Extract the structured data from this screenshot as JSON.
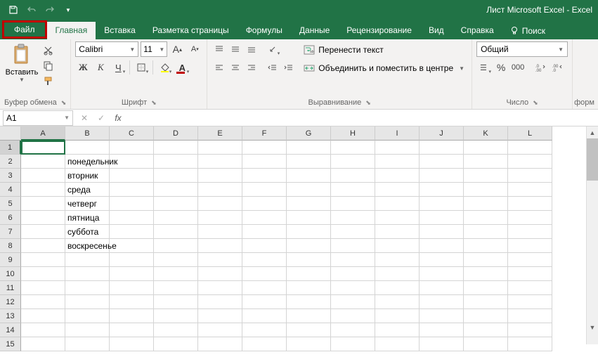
{
  "titlebar": {
    "title": "Лист Microsoft Excel  -  Excel"
  },
  "tabs": {
    "file": "Файл",
    "items": [
      "Главная",
      "Вставка",
      "Разметка страницы",
      "Формулы",
      "Данные",
      "Рецензирование",
      "Вид",
      "Справка"
    ],
    "search": "Поиск",
    "active_index": 0
  },
  "ribbon": {
    "clipboard": {
      "paste": "Вставить",
      "group": "Буфер обмена"
    },
    "font": {
      "name": "Calibri",
      "size": "11",
      "group": "Шрифт",
      "bold": "Ж",
      "italic": "К",
      "underline": "Ч",
      "increase": "A",
      "decrease": "A"
    },
    "alignment": {
      "group": "Выравнивание",
      "wrap": "Перенести текст",
      "merge": "Объединить и поместить в центре"
    },
    "number": {
      "group": "Число",
      "format": "Общий"
    },
    "styles_fragment": "форм"
  },
  "formula_bar": {
    "cell_ref": "A1",
    "fx": "fx",
    "value": ""
  },
  "grid": {
    "columns": [
      "A",
      "B",
      "C",
      "D",
      "E",
      "F",
      "G",
      "H",
      "I",
      "J",
      "K",
      "L"
    ],
    "row_count": 15,
    "active": {
      "row": 1,
      "col": "A"
    },
    "data": {
      "B2": "понедельник",
      "B3": "вторник",
      "B4": "среда",
      "B5": "четверг",
      "B6": "пятница",
      "B7": "суббота",
      "B8": "воскресенье"
    }
  },
  "colors": {
    "brand": "#217346",
    "highlight": "#c00000"
  }
}
